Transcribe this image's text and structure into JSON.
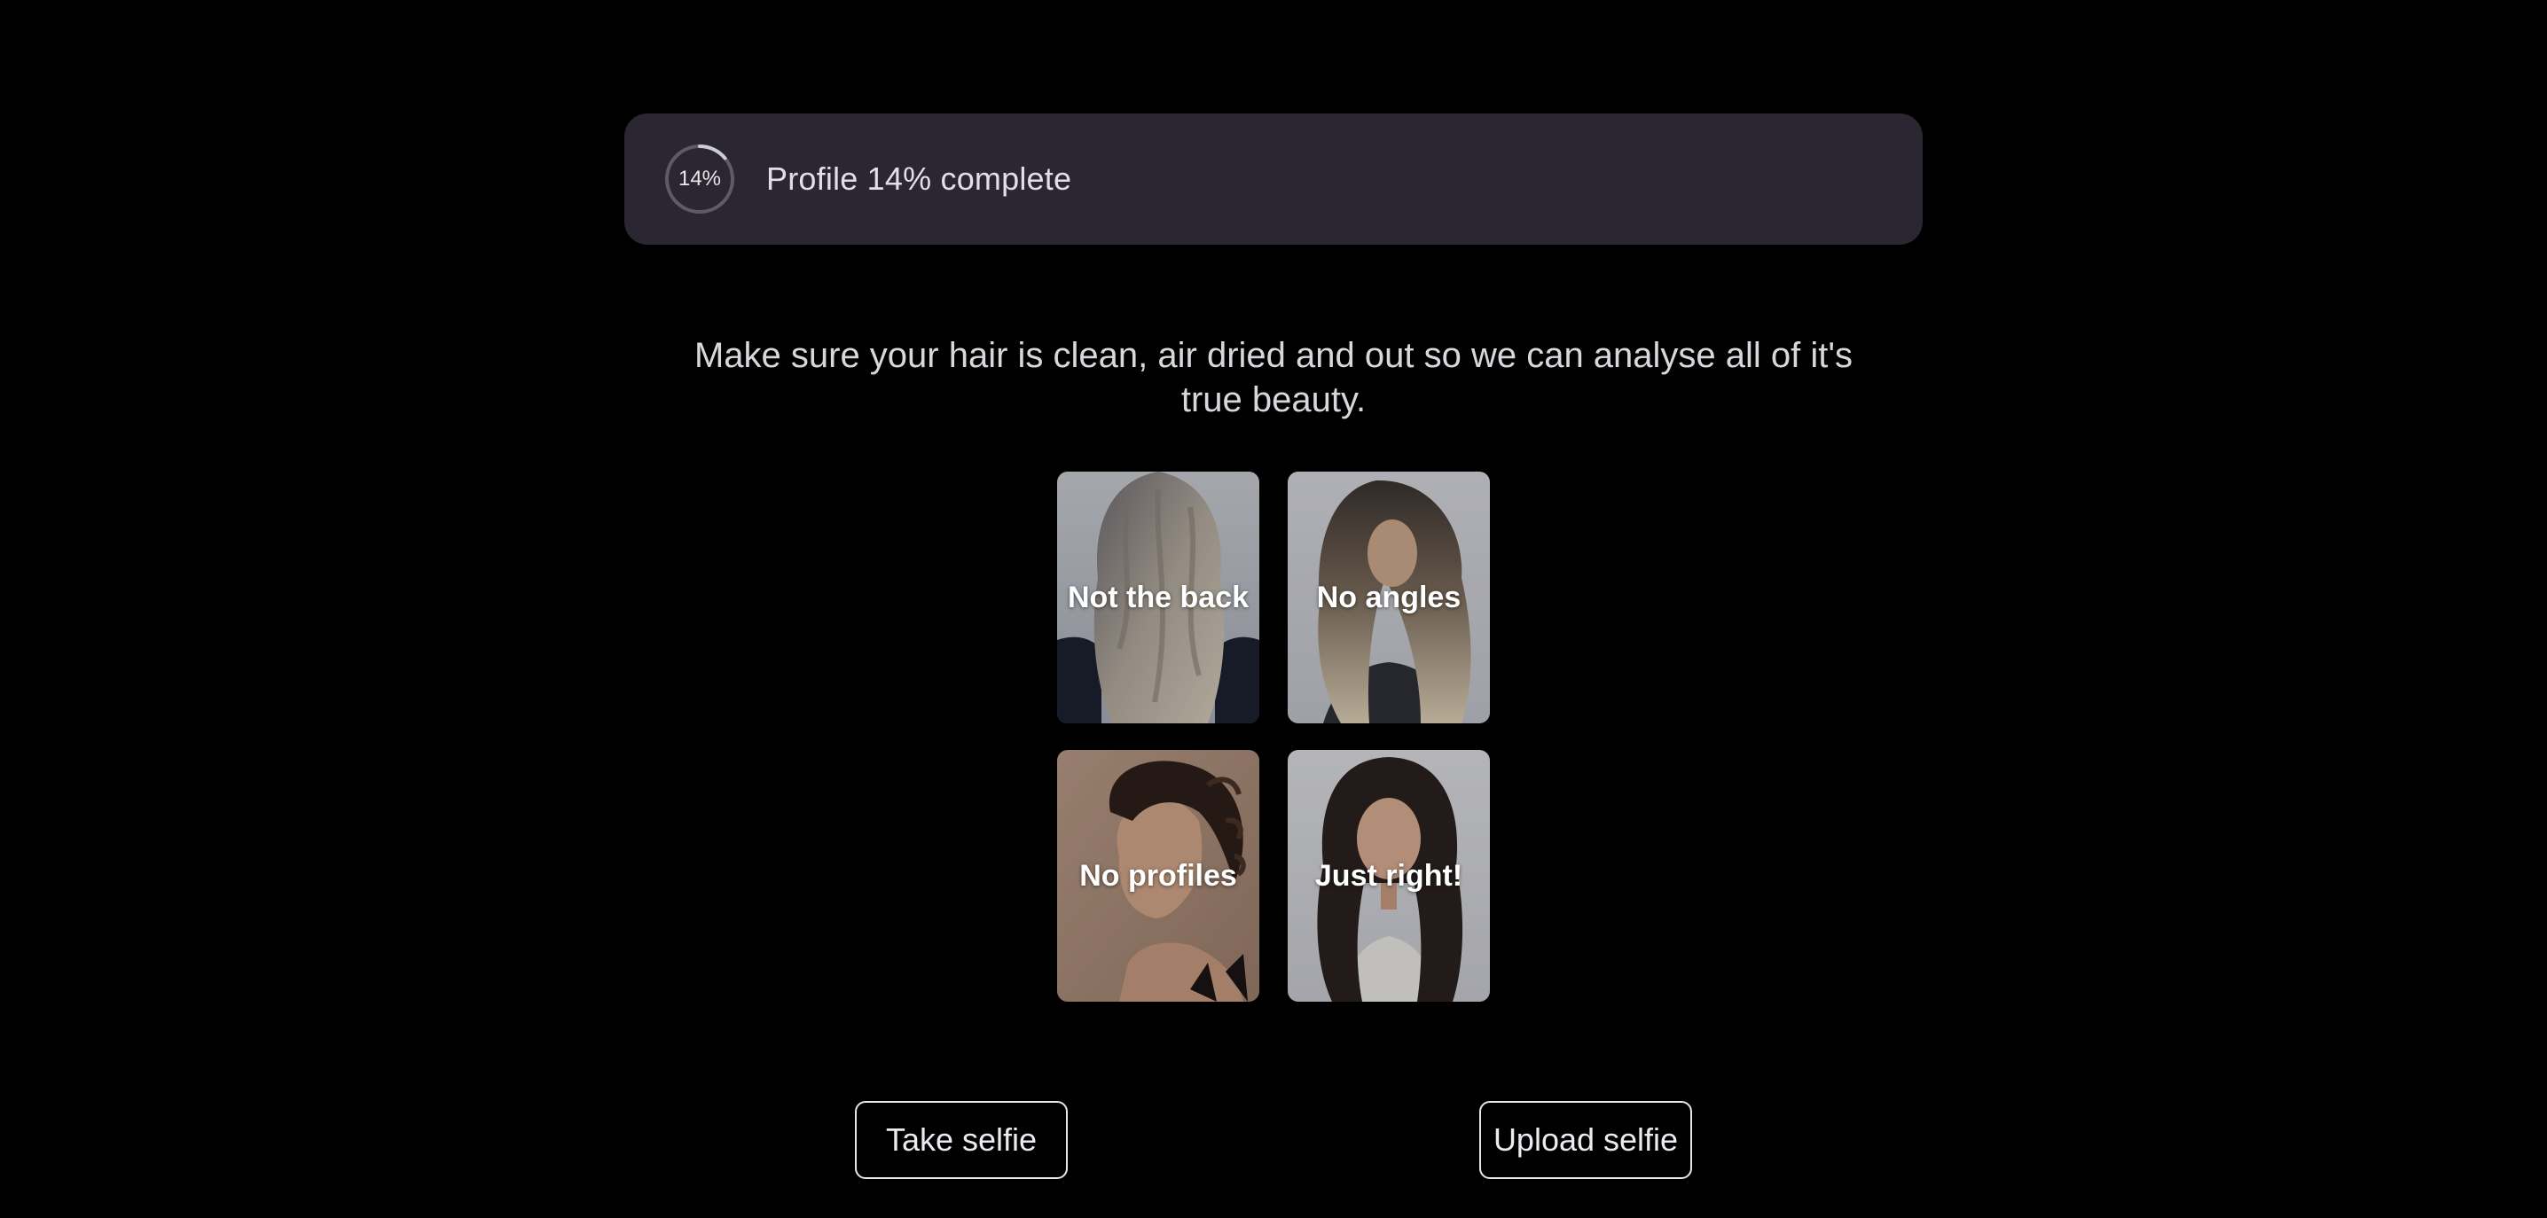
{
  "progress": {
    "ring_label": "14%",
    "text": "Profile 14% complete",
    "fraction": 0.14,
    "track_color": "#5e5b66",
    "fill_color": "#cfcdd4"
  },
  "instruction": {
    "text": "Make sure your hair is clean, air dried and out so we can analyse all of it's true beauty."
  },
  "examples": [
    {
      "label": "Not the back",
      "kind": "back-of-head-photo"
    },
    {
      "label": "No angles",
      "kind": "angled-photo"
    },
    {
      "label": "No profiles",
      "kind": "side-profile-photo"
    },
    {
      "label": "Just right!",
      "kind": "front-facing-photo"
    }
  ],
  "actions": {
    "take_selfie": "Take selfie",
    "upload_selfie": "Upload selfie"
  },
  "colors": {
    "background": "#000000",
    "banner": "#2a2733",
    "text": "#e8e6ea"
  }
}
